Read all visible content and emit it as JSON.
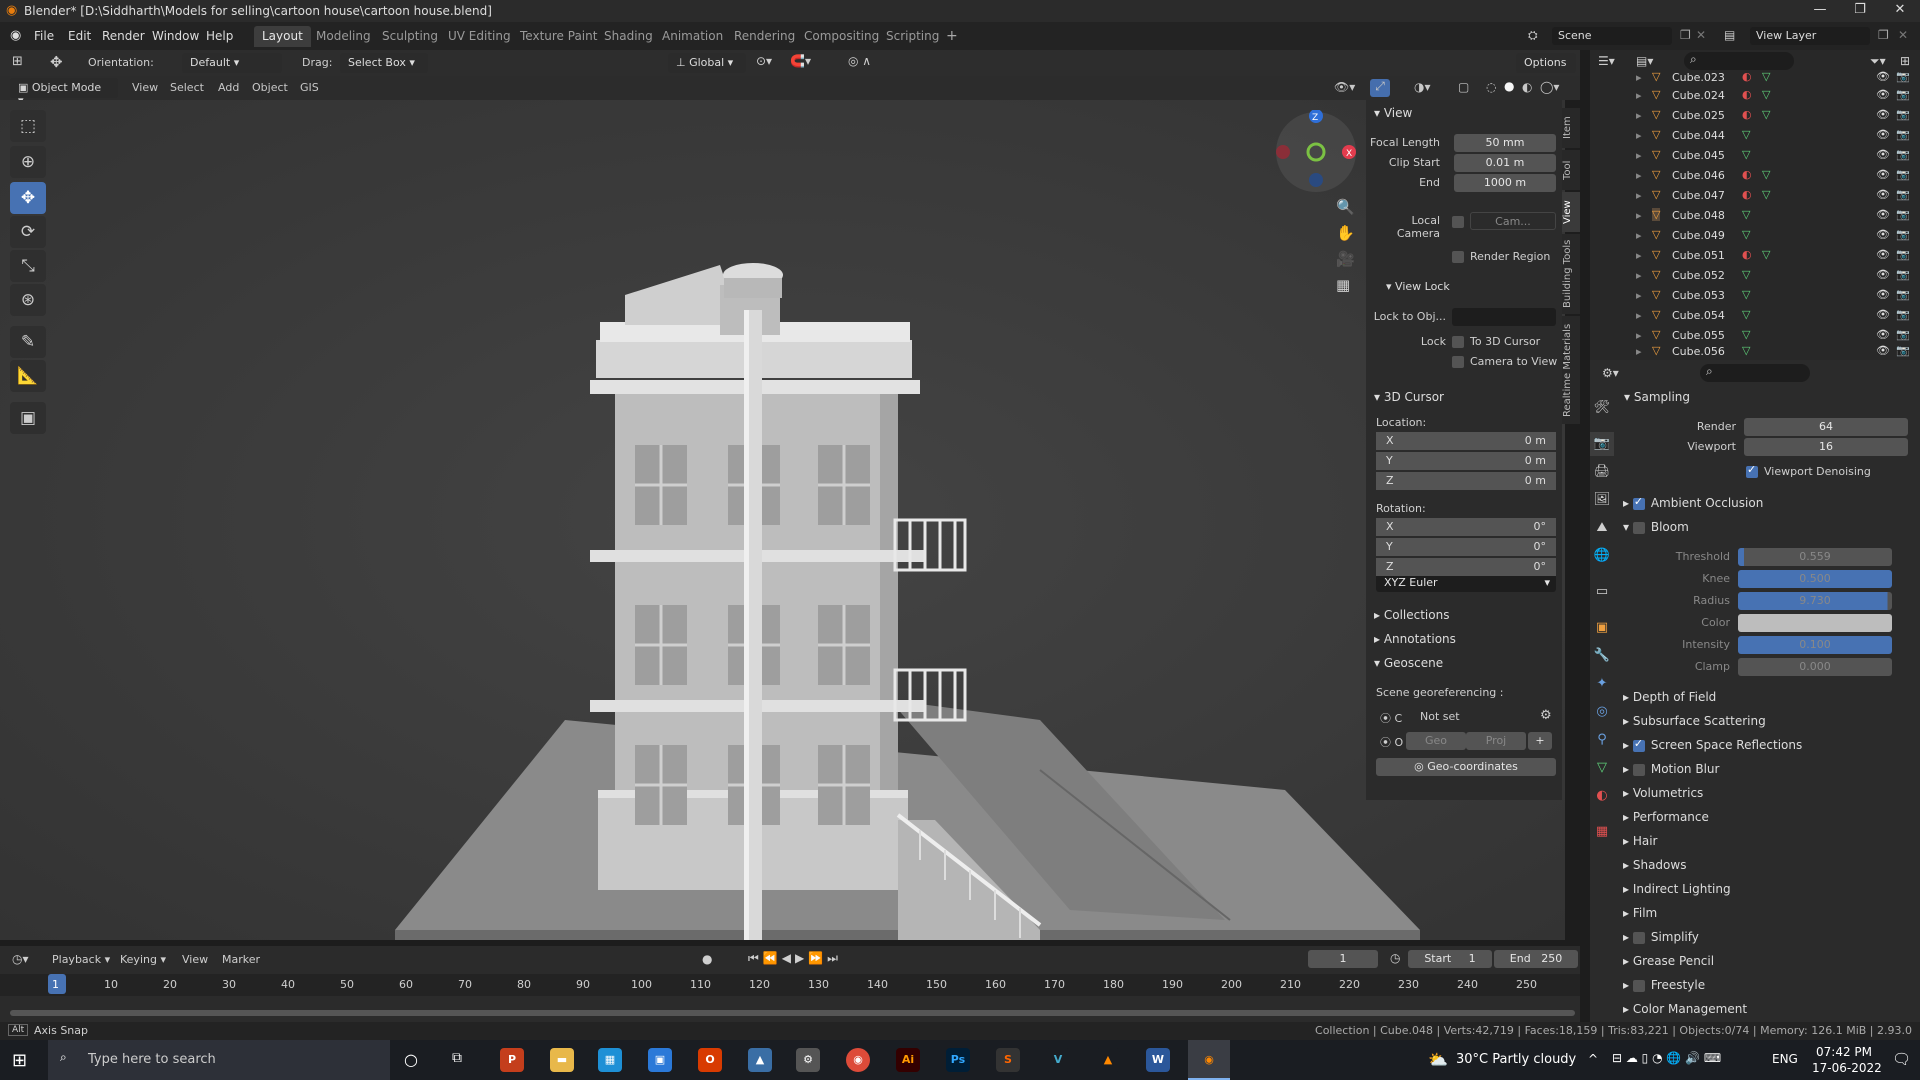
{
  "window": {
    "title": "Blender* [D:\\Siddharth\\Models for selling\\cartoon house\\cartoon house.blend]"
  },
  "menu": [
    "File",
    "Edit",
    "Render",
    "Window",
    "Help"
  ],
  "workspaces": [
    "Layout",
    "Modeling",
    "Sculpting",
    "UV Editing",
    "Texture Paint",
    "Shading",
    "Animation",
    "Rendering",
    "Compositing",
    "Scripting"
  ],
  "scene": {
    "name": "Scene",
    "view_layer": "View Layer"
  },
  "header": {
    "orientation_label": "Orientation:",
    "orientation_value": "Default",
    "drag_label": "Drag:",
    "drag_value": "Select Box",
    "transform": "Global",
    "options": "Options"
  },
  "viewport_header": {
    "mode": "Object Mode",
    "items": [
      "View",
      "Select",
      "Add",
      "Object",
      "GIS"
    ]
  },
  "npanel": {
    "view_title": "View",
    "focal_label": "Focal Length",
    "focal": "50 mm",
    "clip_start_label": "Clip Start",
    "clip_start": "0.01 m",
    "end_label": "End",
    "clip_end": "1000 m",
    "local_camera": "Local Camera",
    "camera_field": "Cam...",
    "render_region": "Render Region",
    "view_lock": "View Lock",
    "lock_obj": "Lock to Obj...",
    "lock": "Lock",
    "to_cursor": "To 3D Cursor",
    "camera_to_view": "Camera to View",
    "cursor_title": "3D Cursor",
    "location": "Location:",
    "rotation": "Rotation:",
    "loc": [
      {
        "axis": "X",
        "v": "0 m"
      },
      {
        "axis": "Y",
        "v": "0 m"
      },
      {
        "axis": "Z",
        "v": "0 m"
      }
    ],
    "rot": [
      {
        "axis": "X",
        "v": "0°"
      },
      {
        "axis": "Y",
        "v": "0°"
      },
      {
        "axis": "Z",
        "v": "0°"
      }
    ],
    "euler": "XYZ Euler",
    "collections": "Collections",
    "annotations": "Annotations",
    "geoscene": "Geoscene",
    "georef": "Scene georeferencing :",
    "crs_c": "C",
    "not_set": "Not set",
    "crs_o": "O",
    "geo": "Geo",
    "proj": "Proj",
    "geocoords": "Geo-coordinates",
    "tabs": [
      "Item",
      "Tool",
      "View",
      "Building Tools",
      "Realtime Materials"
    ]
  },
  "outliner": [
    "Cube.023",
    "Cube.024",
    "Cube.025",
    "Cube.044",
    "Cube.045",
    "Cube.046",
    "Cube.047",
    "Cube.048",
    "Cube.049",
    "Cube.051",
    "Cube.052",
    "Cube.053",
    "Cube.054",
    "Cube.055",
    "Cube.056"
  ],
  "properties": {
    "sampling": "Sampling",
    "render_label": "Render",
    "render": "64",
    "viewport_label": "Viewport",
    "viewport": "16",
    "denoise": "Viewport Denoising",
    "ao": "Ambient Occlusion",
    "bloom": "Bloom",
    "bloom_fields": [
      {
        "l": "Threshold",
        "v": "0.559"
      },
      {
        "l": "Knee",
        "v": "0.500"
      },
      {
        "l": "Radius",
        "v": "9.730"
      },
      {
        "l": "Color",
        "v": ""
      },
      {
        "l": "Intensity",
        "v": "0.100"
      },
      {
        "l": "Clamp",
        "v": "0.000"
      }
    ],
    "sections": [
      "Depth of Field",
      "Subsurface Scattering",
      "Screen Space Reflections",
      "Motion Blur",
      "Volumetrics",
      "Performance",
      "Hair",
      "Shadows",
      "Indirect Lighting",
      "Film",
      "Simplify",
      "Grease Pencil",
      "Freestyle",
      "Color Management"
    ]
  },
  "timeline": {
    "playback": "Playback",
    "keying": "Keying",
    "view": "View",
    "marker": "Marker",
    "frame": "1",
    "start_label": "Start",
    "start": "1",
    "end_label": "End",
    "end": "250",
    "ticks": [
      "1",
      "10",
      "20",
      "30",
      "40",
      "50",
      "60",
      "70",
      "80",
      "90",
      "100",
      "110",
      "120",
      "130",
      "140",
      "150",
      "160",
      "170",
      "180",
      "190",
      "200",
      "210",
      "220",
      "230",
      "240",
      "250"
    ]
  },
  "status": {
    "left": "Axis Snap",
    "right": "Collection | Cube.048 | Verts:42,719 | Faces:18,159 | Tris:83,221 | Objects:0/74 | Memory: 126.1 MiB | 2.93.0"
  },
  "taskbar": {
    "search": "Type here to search",
    "weather": "30°C  Partly cloudy",
    "lang": "ENG",
    "time": "07:42 PM",
    "date": "17-06-2022"
  }
}
